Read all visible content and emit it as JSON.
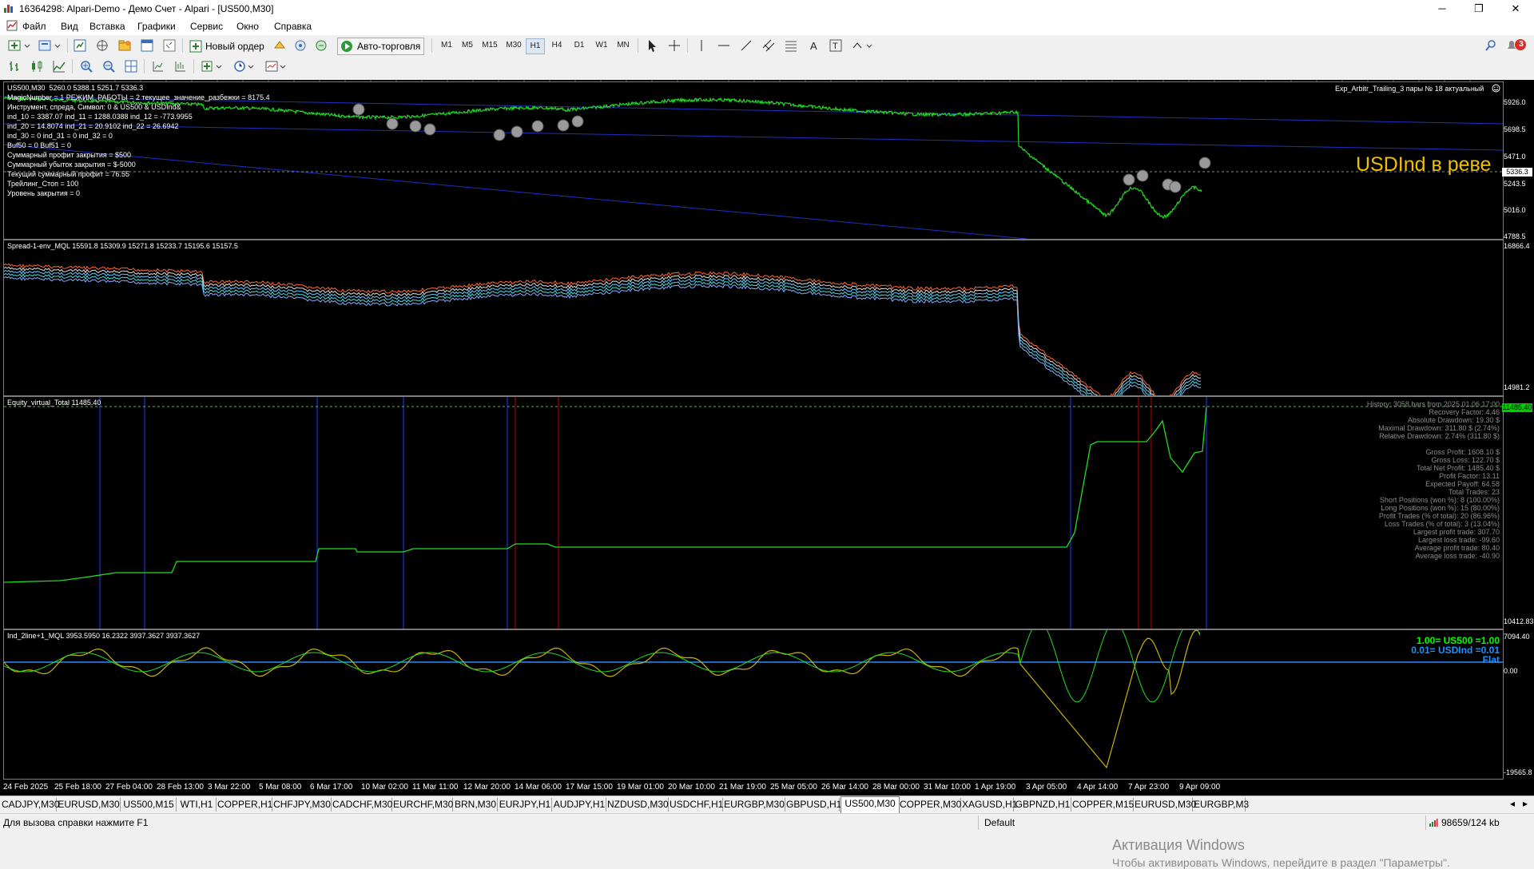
{
  "window": {
    "title": "16364298: Alpari-Demo - Демо Счет - Alpari - [US500,M30]",
    "buttons": [
      "─",
      "❐",
      "✕"
    ]
  },
  "menu": {
    "items": [
      "Файл",
      "Вид",
      "Вставка",
      "Графики",
      "Сервис",
      "Окно",
      "Справка"
    ],
    "mdi_buttons": [
      "─",
      "❐",
      "✕"
    ]
  },
  "toolbar1": {
    "new_order": "Новый ордер",
    "autotrading": "Авто-торговля",
    "timeframes": [
      "M1",
      "M5",
      "M15",
      "M30",
      "H1",
      "H4",
      "D1",
      "W1",
      "MN"
    ],
    "active_timeframe": "H1",
    "notification_count": "3"
  },
  "chart_main": {
    "header": "US500,M30  5260.0 5388.1 5251.7 5336.3",
    "ea_label": "Exp_Arbitr_Trailing_3 пары № 18 актуальный",
    "overlay_text": "USDInd в реве",
    "overlay_color": "#f0c000",
    "info_lines": [
      "MagicNumber = 1 РЕЖИМ_РАБОТЫ = 2 текущее_значение_разбежки = 8175.4",
      "Инструмент, спреда, Символ: 0 & US500 & USDInd&",
      "ind_10 = 3387.07 ind_11 = 1288.0388 ind_12 = -773.9955",
      "ind_20 = 14.8074 ind_21 = 20.9102 ind_22 = 26.6942",
      "ind_30 = 0 ind_31 = 0 ind_32 = 0",
      "Buf50 = 0 Buf51 = 0",
      "Суммарный профит закрытия = $500",
      "Суммарный убыток закрытия = $-5000",
      "Текущий суммарный профит = 76.55",
      "Трейлинг_Стоп = 100",
      "Уровень закрытия = 0"
    ],
    "price_ticks": [
      "5926.0",
      "5698.5",
      "5471.0",
      "5243.5",
      "5016.0",
      "4788.5"
    ],
    "current_price": "5336.3"
  },
  "chart_spread": {
    "header": "Spread-1-env_MQL 15591.8 15309.9 15271.8 15233.7 15195.6 15157.5",
    "price_ticks": [
      "16866.4",
      "14981.2"
    ]
  },
  "chart_equity": {
    "header": "Equity_virtual_Total 11485.40",
    "price_ticks": [
      "10412.83"
    ],
    "current_value": "11485.40",
    "stats": [
      "History: 3058 bars from 2025.01.06 17:00",
      "Recovery Factor: 4.46",
      "Absolute Drawdown: 19.30 $",
      "Maximal Drawdown: 311.80 $ (2.74%)",
      "Relative Drawdown: 2.74% (311.80 $)",
      "",
      "Gross Profit: 1608.10 $",
      "Gross Loss: 122.70 $",
      "Total Net Profit: 1485.40 $",
      "Profit Factor: 13.11",
      "Expected Payoff: 64.58",
      "Total Trades: 23",
      "Short Positions (won %): 8 (100.00%)",
      "Long Positions (won %): 15 (80.00%)",
      "Profit Trades (% of total): 20 (86.96%)",
      "Loss Trades (% of total): 3 (13.04%)",
      "Largest profit trade: 307.70",
      "Largest loss trade: -99.60",
      "Average profit trade: 80.40",
      "Average loss trade: -40.90"
    ]
  },
  "chart_ind": {
    "header": "Ind_2line+1_MQL 3953.5950 16.2322 3937.3627 3937.3627",
    "legend": [
      {
        "text": "1.00= US500 =1.00",
        "color": "#00ff00"
      },
      {
        "text": "0.01= USDInd =0.01",
        "color": "#1e90ff"
      },
      {
        "text": "Flat",
        "color": "#1e90ff"
      }
    ],
    "price_ticks": [
      "7094.40",
      "0.00",
      "-19565.8"
    ]
  },
  "time_axis": [
    "24 Feb 2025",
    "25 Feb 18:00",
    "27 Feb 04:00",
    "28 Feb 13:00",
    "3 Mar 22:00",
    "5 Mar 08:00",
    "6 Mar 17:00",
    "10 Mar 02:00",
    "11 Mar 11:00",
    "12 Mar 20:00",
    "14 Mar 06:00",
    "17 Mar 15:00",
    "19 Mar 01:00",
    "20 Mar 10:00",
    "21 Mar 19:00",
    "25 Mar 05:00",
    "26 Mar 14:00",
    "28 Mar 00:00",
    "31 Mar 10:00",
    "1 Apr 19:00",
    "3 Apr 05:00",
    "4 Apr 14:00",
    "7 Apr 23:00",
    "9 Apr 09:00"
  ],
  "watermark": {
    "line1": "Активация Windows",
    "line2": "Чтобы активировать Windows, перейдите в раздел \"Параметры\"."
  },
  "tabs": [
    "CADJPY,M30",
    "EURUSD,M30",
    "US500,M15",
    "WTI,H1",
    "COPPER,H1",
    "CHFJPY,M30",
    "CADCHF,M30",
    "EURCHF,M30",
    "BRN,M30",
    "EURJPY,H1",
    "AUDJPY,H1",
    "NZDUSD,M30",
    "USDCHF,H1",
    "EURGBP,M30",
    "GBPUSD,H1",
    "US500,M30",
    "COPPER,M30",
    "XAGUSD,H1",
    "GBPNZD,H1",
    "COPPER,M15",
    "EURUSD,M30",
    "EURGBP,M3"
  ],
  "active_tab": "US500,M30",
  "status": {
    "help": "Для вызова справки нажмите F1",
    "profile": "Default",
    "traffic": "98659/124 kb"
  }
}
